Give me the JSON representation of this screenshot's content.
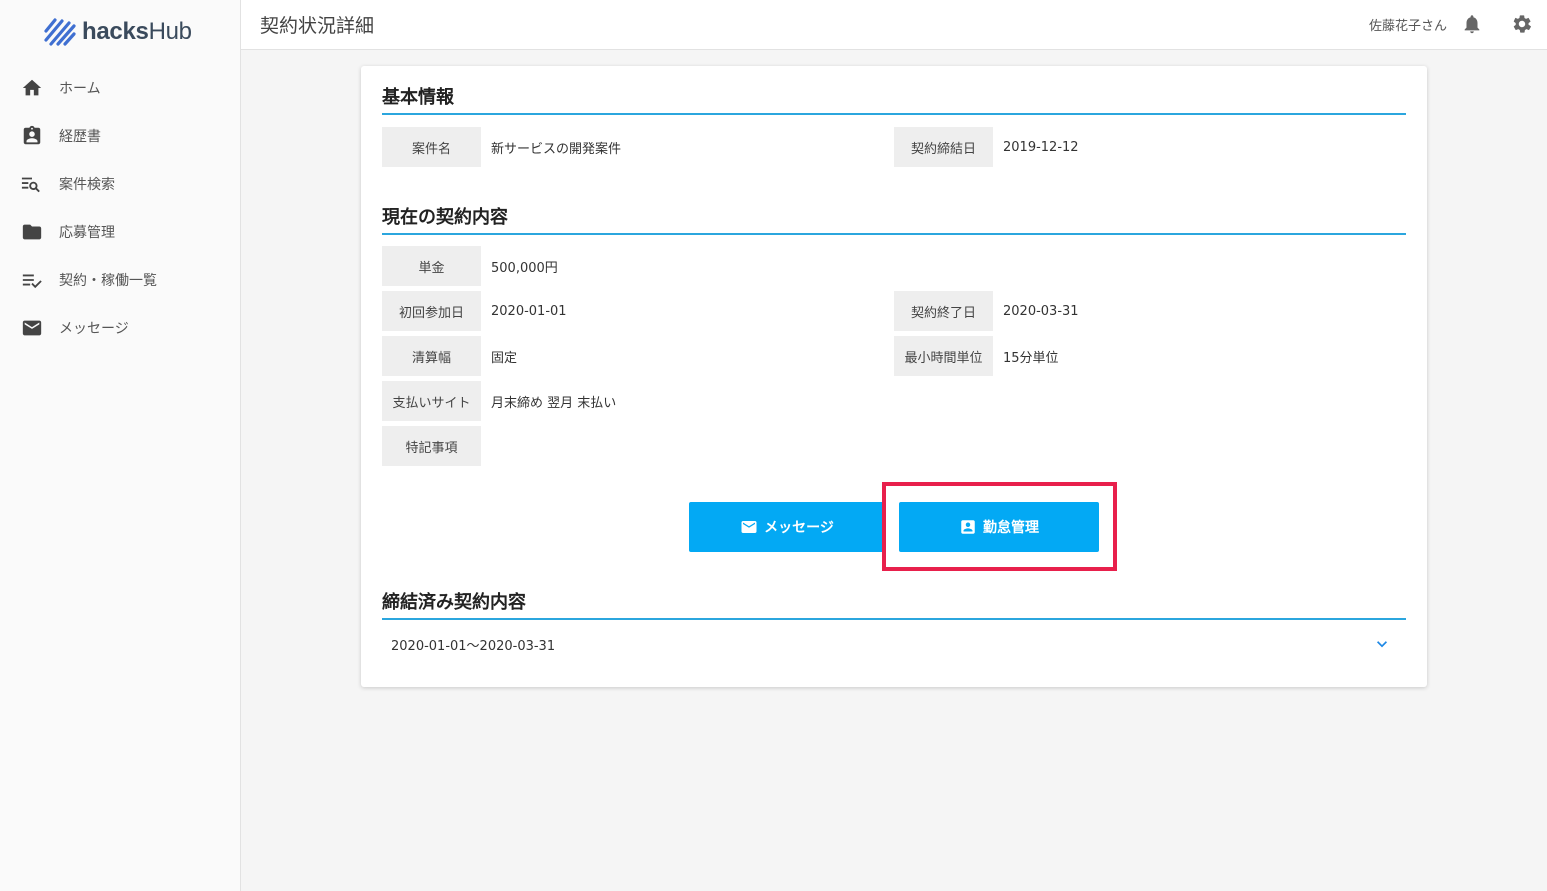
{
  "app": {
    "logo_bold": "hacks",
    "logo_light": "Hub",
    "page_title": "契約状況詳細",
    "user_name": "佐藤花子さん"
  },
  "sidebar": {
    "items": [
      {
        "label": "ホーム",
        "icon": "home-icon"
      },
      {
        "label": "経歴書",
        "icon": "badge-icon"
      },
      {
        "label": "案件検索",
        "icon": "list-search-icon"
      },
      {
        "label": "応募管理",
        "icon": "folder-icon"
      },
      {
        "label": "契約・稼働一覧",
        "icon": "checklist-icon"
      },
      {
        "label": "メッセージ",
        "icon": "mail-icon"
      }
    ]
  },
  "basic": {
    "title": "基本情報",
    "project_label": "案件名",
    "project_value": "新サービスの開発案件",
    "signed_label": "契約締結日",
    "signed_value": "2019-12-12"
  },
  "current": {
    "title": "現在の契約内容",
    "price_label": "単金",
    "price_value": "500,000円",
    "start_label": "初回参加日",
    "start_value": "2020-01-01",
    "end_label": "契約終了日",
    "end_value": "2020-03-31",
    "settle_label": "清算幅",
    "settle_value": "固定",
    "unit_label": "最小時間単位",
    "unit_value": "15分単位",
    "payment_label": "支払いサイト",
    "payment_value": "月末締め 翌月 末払い",
    "notes_label": "特記事項",
    "notes_value": ""
  },
  "actions": {
    "message_label": "メッセージ",
    "attendance_label": "勤怠管理"
  },
  "signed_contracts": {
    "title": "締結済み契約内容",
    "items": [
      "2020-01-01〜2020-03-31"
    ]
  },
  "colors": {
    "accent": "#03a9f4",
    "rule": "#2ba6de",
    "highlight": "#e8204c"
  }
}
